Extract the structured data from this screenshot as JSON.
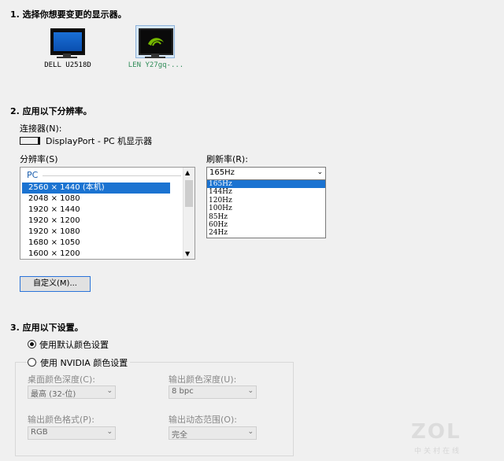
{
  "steps": {
    "s1": "1. 选择你想要变更的显示器。",
    "s2": "2. 应用以下分辨率。",
    "s3": "3. 应用以下设置。"
  },
  "monitors": [
    {
      "label": "DELL U2518D",
      "selected": false
    },
    {
      "label": "LEN Y27gq-...",
      "selected": true
    }
  ],
  "connector": {
    "label": "连接器(N):",
    "value": "DisplayPort - PC 机显示器"
  },
  "resolution": {
    "label": "分辨率(S)",
    "group": "PC",
    "items": [
      "2560 × 1440 (本机)",
      "2048 × 1080",
      "1920 × 1440",
      "1920 × 1200",
      "1920 × 1080",
      "1680 × 1050",
      "1600 × 1200"
    ],
    "selected_index": 0
  },
  "refresh": {
    "label": "刷新率(R):",
    "value": "165Hz",
    "options": [
      "165Hz",
      "144Hz",
      "120Hz",
      "100Hz",
      "85Hz",
      "60Hz",
      "24Hz"
    ],
    "selected_index": 0
  },
  "custom_button": "自定义(M)...",
  "settings": {
    "radio_default": "使用默认颜色设置",
    "radio_nvidia": "使用 NVIDIA 颜色设置",
    "desktop_depth_label": "桌面颜色深度(C):",
    "desktop_depth_value": "最高 (32-位)",
    "output_depth_label": "输出颜色深度(U):",
    "output_depth_value": "8 bpc",
    "output_format_label": "输出颜色格式(P):",
    "output_format_value": "RGB",
    "output_range_label": "输出动态范围(O):",
    "output_range_value": "完全"
  },
  "watermark": {
    "logo": "ZOL",
    "sub": "中关村在线"
  }
}
